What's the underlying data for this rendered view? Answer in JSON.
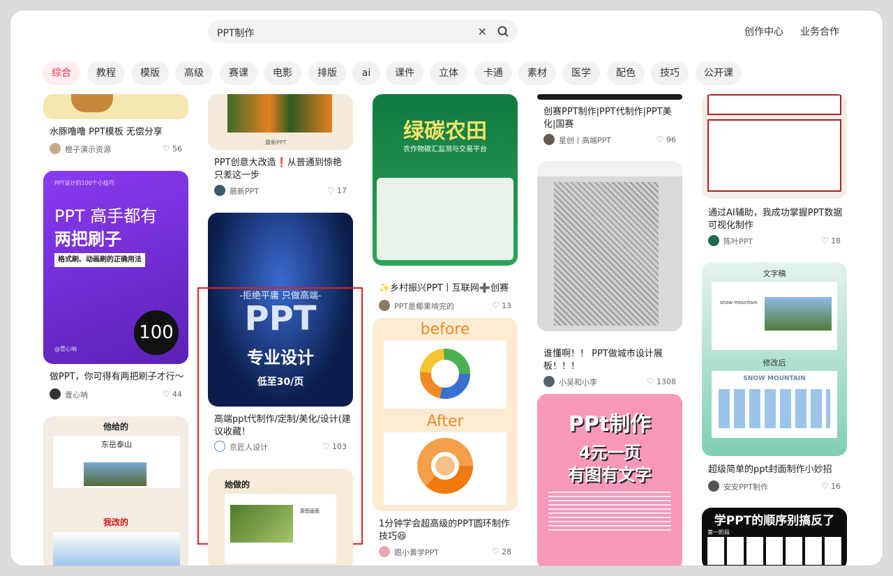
{
  "search": {
    "value": "PPT制作"
  },
  "topnav": {
    "creator": "创作中心",
    "business": "业务合作"
  },
  "categories": [
    "综合",
    "教程",
    "模版",
    "高级",
    "赛课",
    "电影",
    "排版",
    "ai",
    "课件",
    "立体",
    "卡通",
    "素材",
    "医学",
    "配色",
    "技巧",
    "公开课"
  ],
  "cards": {
    "c1": {
      "title": "水豚噜噜 PPT模板 无偿分享",
      "author": "橙子演示资源",
      "likes": "56"
    },
    "c2": {
      "title": "做PPT，你可得有两把刷子才行～",
      "author": "壹心呐",
      "likes": "44",
      "img_line1": "PPT 高手都有",
      "img_line2": "两把刷子",
      "img_sub": "格式刷、动画刷的正确用法",
      "img_top": "PPT设计的100个小技巧",
      "img_badge": "100",
      "img_sign": "@壹心呐"
    },
    "c3": {
      "img_top": "他给的",
      "img_mid": "我改的",
      "img_t1": "东岳泰山"
    },
    "c4": {
      "title": "PPT创意大改造❗️从普通到惊艳只差这一步",
      "author": "晨新PPT",
      "likes": "17",
      "img_tag": "晨新PPT"
    },
    "c5": {
      "title": "高端ppt代制作/定制/美化/设计(建议收藏！",
      "author": "京匠人设计",
      "likes": "103",
      "img_l1": "-拒绝平庸 只做高端-",
      "img_l2": "PPT",
      "img_l3": "专业设计",
      "img_l4": "低至30/页"
    },
    "c6": {
      "img_top": "她做的",
      "img_side": "原图画面"
    },
    "c7": {
      "title": "✨乡村振兴PPT丨互联网➕创赛",
      "author": "PPT是椰果啃完的",
      "likes": "13",
      "img_big": "绿碳农田",
      "img_sub": "农作物碳汇监测与交易平台"
    },
    "c8": {
      "title": "1分钟学会超高级的PPT圆环制作技巧😆",
      "author": "跟小黄学PPT",
      "likes": "28",
      "img_before": "before",
      "img_after": "After"
    },
    "c9": {
      "title": "创赛PPT制作|PPT代制作|PPT美化|国赛",
      "author": "星创丨高端PPT",
      "likes": "96"
    },
    "c10": {
      "title": "谁懂啊！！ PPT做城市设计展板！！！",
      "author": "小吴和小李",
      "likes": "1308"
    },
    "c11": {
      "img_l1": "PPt制作",
      "img_l2": "4元一页",
      "img_l3": "有图有文字"
    },
    "c12": {
      "title": "通过AI辅助，我成功掌握PPT数据可视化制作",
      "author": "陈叶PPT",
      "likes": "18"
    },
    "c13": {
      "title": "超级简单的ppt封面制作小妙招",
      "author": "安安PPT制作",
      "likes": "16",
      "img_top": "文字稿",
      "img_mid": "修改后",
      "img_t1": "snow mountain",
      "img_t2": "SNOW MOUNTAIN"
    },
    "c14": {
      "img_title": "学PPT的顺序别搞反了",
      "img_sub": "第一阶段"
    }
  },
  "colors": {
    "accent": "#ff2442",
    "highlight": "#e02020"
  }
}
